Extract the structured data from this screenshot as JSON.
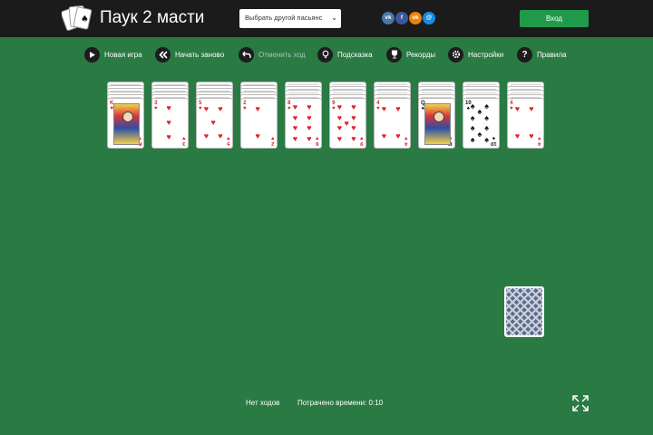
{
  "header": {
    "title": "Паук 2 масти",
    "game_select": {
      "value": "Выбрать другой пасьянс"
    },
    "social": [
      {
        "name": "vk-icon",
        "label": "vk",
        "color": "#4a76a8"
      },
      {
        "name": "facebook-icon",
        "label": "f",
        "color": "#3b5998"
      },
      {
        "name": "odnoklassniki-icon",
        "label": "ok",
        "color": "#ee8208"
      },
      {
        "name": "mailru-icon",
        "label": "@",
        "color": "#168de2"
      }
    ],
    "login_label": "Вход",
    "login_color": "#1f9a4a"
  },
  "toolbar": {
    "new_game": "Новая игра",
    "restart": "Начать заново",
    "undo": "Отменить ход",
    "hint": "Подсказка",
    "records": "Рекорды",
    "settings": "Настройки",
    "rules": "Правила"
  },
  "tableau": {
    "columns": [
      {
        "face_down": 5,
        "top_card": {
          "rank": "K",
          "suit": "♥",
          "color": "red"
        }
      },
      {
        "face_down": 5,
        "top_card": {
          "rank": "3",
          "suit": "♥",
          "color": "red"
        }
      },
      {
        "face_down": 5,
        "top_card": {
          "rank": "5",
          "suit": "♥",
          "color": "red"
        }
      },
      {
        "face_down": 5,
        "top_card": {
          "rank": "2",
          "suit": "♥",
          "color": "red"
        }
      },
      {
        "face_down": 4,
        "top_card": {
          "rank": "8",
          "suit": "♥",
          "color": "red"
        }
      },
      {
        "face_down": 4,
        "top_card": {
          "rank": "9",
          "suit": "♥",
          "color": "red"
        }
      },
      {
        "face_down": 4,
        "top_card": {
          "rank": "4",
          "suit": "♥",
          "color": "red"
        }
      },
      {
        "face_down": 4,
        "top_card": {
          "rank": "Q",
          "suit": "♠",
          "color": "black"
        }
      },
      {
        "face_down": 4,
        "top_card": {
          "rank": "10",
          "suit": "♠",
          "color": "black"
        }
      },
      {
        "face_down": 4,
        "top_card": {
          "rank": "4",
          "suit": "♥",
          "color": "red"
        }
      }
    ]
  },
  "footer": {
    "moves": "Нет ходов",
    "time": "Потрачено времени: 0:10"
  },
  "colors": {
    "table_green": "#2a7a43",
    "header_bg": "#1b1b1b"
  }
}
